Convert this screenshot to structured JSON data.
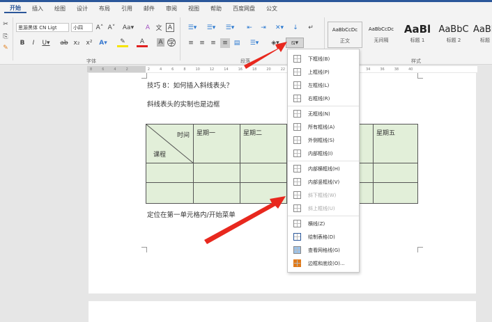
{
  "tabs": [
    "开始",
    "插入",
    "绘图",
    "设计",
    "布局",
    "引用",
    "邮件",
    "审阅",
    "视图",
    "帮助",
    "百度网盘",
    "公文"
  ],
  "font": {
    "name": "思源黑体 CN Ligt",
    "size": "小四",
    "group_label": "字体"
  },
  "paragraph": {
    "group_label": "段落"
  },
  "styles": {
    "group_label": "样式",
    "items": [
      {
        "preview": "AaBbCcDc",
        "label": "正文"
      },
      {
        "preview": "AaBbCcDc",
        "label": "无间隔"
      },
      {
        "preview": "AaBl",
        "label": "标题 1"
      },
      {
        "preview": "AaBbC",
        "label": "标题 2"
      },
      {
        "preview": "AaBb",
        "label": "标题"
      }
    ]
  },
  "ruler": [
    "8",
    "6",
    "4",
    "2",
    "",
    "2",
    "4",
    "6",
    "8",
    "10",
    "12",
    "14",
    "16",
    "18",
    "20",
    "22",
    "24",
    "26",
    "28",
    "30",
    "32",
    "34",
    "36",
    "38",
    "40"
  ],
  "document": {
    "heading": "技巧 8：如何插入斜线表头？",
    "subtitle": "斜线表头的实制也是边框",
    "table": {
      "corner_top": "时间",
      "corner_bottom": "课程",
      "headers": [
        "星期一",
        "星期二",
        "",
        "",
        "星期五"
      ]
    },
    "instruction": "定位在第一单元格内/开始菜单"
  },
  "border_menu": [
    {
      "label": "下框线(B)"
    },
    {
      "label": "上框线(P)"
    },
    {
      "label": "左框线(L)"
    },
    {
      "label": "右框线(R)"
    },
    {
      "label": "无框线(N)"
    },
    {
      "label": "所有框线(A)"
    },
    {
      "label": "外侧框线(S)"
    },
    {
      "label": "内部框线(I)"
    },
    {
      "label": "内部横框线(H)"
    },
    {
      "label": "内部竖框线(V)"
    },
    {
      "label": "斜下框线(W)",
      "disabled": true
    },
    {
      "label": "斜上框线(U)",
      "disabled": true
    },
    {
      "label": "横线(Z)"
    },
    {
      "label": "绘制表格(D)"
    },
    {
      "label": "查看网格线(G)"
    },
    {
      "label": "边框和底纹(O)..."
    }
  ],
  "colors": {
    "accent": "#2b579a",
    "table_fill": "#e2efd9",
    "arrow": "#e8281e"
  }
}
